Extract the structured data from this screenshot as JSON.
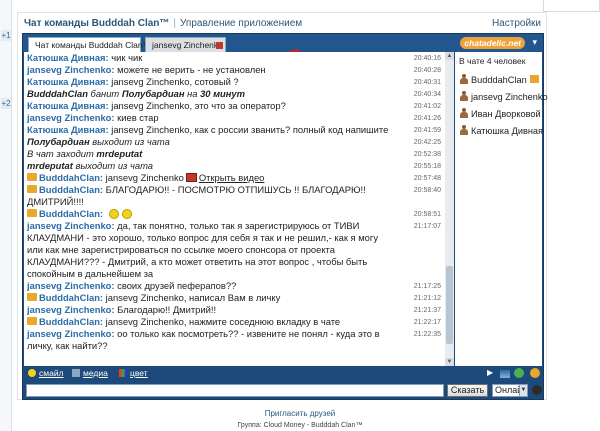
{
  "left_strip": {
    "badges": [
      "+1",
      "+2"
    ]
  },
  "header": {
    "title": "Чат команды Budddah Clan™",
    "separator": "|",
    "manage_link": "Управление приложением",
    "settings_link": "Настройки"
  },
  "tabs": [
    {
      "label": "Чат команды Budddah Clan™",
      "active": true
    },
    {
      "label": "jansevg Zinchenko",
      "active": false
    }
  ],
  "brand": {
    "label": "chatadelic.net",
    "icon": "chevron-down-icon"
  },
  "messages": [
    {
      "nick": "Катюшка Дивная:",
      "text": "чик чик",
      "time": "20:40:16"
    },
    {
      "nick": "jansevg Zinchenko:",
      "text": "можете не верить - не установлен",
      "time": "20:40:28"
    },
    {
      "nick": "Катюшка Дивная:",
      "text": "jansevg Zinchenko, сотовый ?",
      "time": "20:40:31"
    },
    {
      "system": true,
      "parts": [
        "BudddahClan",
        " банит ",
        "Полубардиан",
        " на ",
        "30 минут"
      ],
      "time": "20:40:34"
    },
    {
      "nick": "Катюшка Дивная:",
      "text": "jansevg Zinchenko, это что за оператор?",
      "time": "20:41:02"
    },
    {
      "nick": "jansevg Zinchenko:",
      "text": "киев стар",
      "time": "20:41:26"
    },
    {
      "nick": "Катюшка Дивная:",
      "text": "jansevg Zinchenko, как с россии званить? полный код напишите",
      "time": "20:41:59"
    },
    {
      "system": true,
      "parts": [
        "Полубардиан",
        " выходит из чата"
      ],
      "time": "20:42:25"
    },
    {
      "system": true,
      "parts": [
        "В чат заходит ",
        "mrdeputat"
      ],
      "time": "20:52:38"
    },
    {
      "system": true,
      "parts": [
        "mrdeputat",
        " выходит из чата"
      ],
      "time": "20:55:18"
    },
    {
      "nick": "BudddahClan:",
      "text": "jansevg Zinchenko",
      "link": "Открыть видео",
      "time": "20:57:48",
      "crown": true,
      "video": true
    },
    {
      "nick": "BudddahClan:",
      "text": "БЛАГОДАРЮ!! - ПОСМОТРЮ ОТПИШУСЬ !! БЛАГОДАРЮ!! ДМИТРИЙ!!!!",
      "time": "20:58:40",
      "crown": true
    },
    {
      "nick": "BudddahClan:",
      "text": "",
      "time": "20:58:51",
      "crown": true,
      "smileys": true
    },
    {
      "nick": "jansevg Zinchenko:",
      "text": "да, так понятно, только так я зарегистрируюсь от ТИВИ КЛАУДМАНИ - это хорошо, только вопрос для себя я так и не решил,- как я могу или как мне зарегистрироваться по ссылке моего спонсора от проекта КЛАУДМАНИ??? - Дмитрий, а кто может ответить на этот вопрос , чтобы быть спокойным в дальнейшем за",
      "time": "21:17:07"
    },
    {
      "nick": "jansevg Zinchenko:",
      "text": "своих друзей пеферапов??",
      "time": "21:17:25"
    },
    {
      "nick": "BudddahClan:",
      "text": "jansevg Zinchenko, написал Вам в личку",
      "time": "21:21:12",
      "crown": true
    },
    {
      "nick": "jansevg Zinchenko:",
      "text": "Благодарю!! Дмитрий!!",
      "time": "21:21:37"
    },
    {
      "nick": "BudddahClan:",
      "text": "jansevg Zinchenko, нажмите соседнюю вкладку в чате",
      "time": "21:22:17",
      "crown": true
    },
    {
      "nick": "jansevg Zinchenko:",
      "text": "оо только как посмотреть?? - извените не понял - куда это в личку, как найти??",
      "time": "21:22:35"
    }
  ],
  "users_panel": {
    "count_label": "В чате 4 человек",
    "users": [
      {
        "name": "BudddahClan",
        "crown": true
      },
      {
        "name": "jansevg Zinchenko",
        "crown": false
      },
      {
        "name": "Иван Дворковой",
        "crown": false
      },
      {
        "name": "Катюшка Дивная",
        "crown": false
      }
    ]
  },
  "toolbar": {
    "smile_label": "смайл",
    "media_label": "медиа",
    "color_label": "цвет"
  },
  "input": {
    "value": "",
    "send_label": "Сказать",
    "status_value": "Онлайн"
  },
  "footer": {
    "invite_link": "Пригласить друзей",
    "group_text": "Группа: Cloud Money - Budddah Clan™"
  },
  "colors": {
    "frame": "#1d4a7a",
    "nick": "#2b6ca8",
    "link": "#2b587a",
    "arrow": "#d42020",
    "crown": "#e8a82c"
  }
}
